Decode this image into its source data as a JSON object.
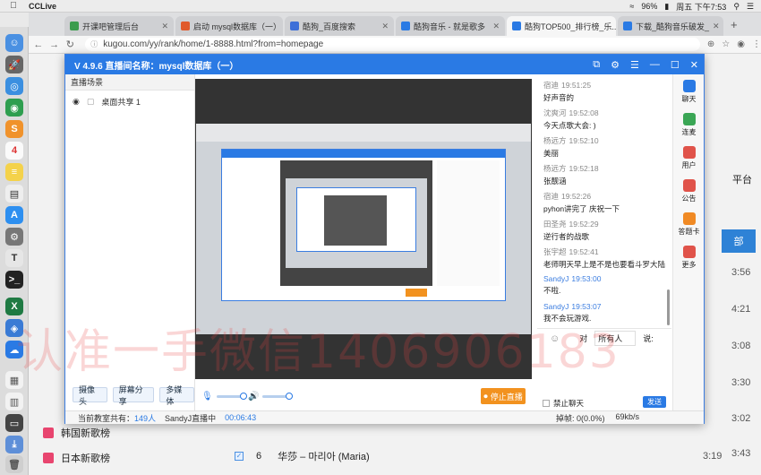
{
  "menubar": {
    "app_name": "CCLive",
    "battery": "96%",
    "clock": "周五 下午7:53"
  },
  "tabs": [
    {
      "label": "开课吧管理后台",
      "color": "#3b9c4d"
    },
    {
      "label": "启动 mysql数据库（一）",
      "color": "#e05a2b"
    },
    {
      "label": "酷狗_百度搜索",
      "color": "#3d6fd8"
    },
    {
      "label": "酷狗音乐 - 就是歌多",
      "color": "#2a7ae4"
    },
    {
      "label": "酷狗TOP500_排行榜_乐...",
      "color": "#2a7ae4"
    },
    {
      "label": "下载_酷狗音乐破发_",
      "color": "#2a7ae4"
    }
  ],
  "browser": {
    "url": "kugou.com/yy/rank/home/1-8888.html?from=homepage",
    "new_tab": "+"
  },
  "kugou": {
    "platform": "平台",
    "all_button": "部",
    "ranks": [
      {
        "label": "韩国新歌榜"
      },
      {
        "label": "日本新歌榜"
      }
    ],
    "song": {
      "index": "6",
      "name": "华莎 – 마리아 (Maria)",
      "duration": "3:19"
    },
    "times": [
      "3:56",
      "4:21",
      "3:08",
      "3:30",
      "3:02",
      "3:43"
    ]
  },
  "app": {
    "title": "V 4.9.6  直播间名称：mysql数据库（一）",
    "left_header": "直播场景",
    "share_label": "桌面共享 1",
    "buttons": {
      "camera": "摄像头",
      "screen": "屏幕分享",
      "media": "多媒体"
    },
    "stop_label": "停止直播",
    "status": {
      "prefix": "当前教室共有：",
      "count": "149人",
      "host": "SandyJ直播中",
      "timer": "00:06:43",
      "loss": "掉帧: 0(0.0%)",
      "speed": "69kb/s"
    },
    "chat": {
      "messages": [
        {
          "who": "宿迪",
          "time": "19:51:25",
          "text": "好声音的",
          "teacher": false
        },
        {
          "who": "沈爽河",
          "time": "19:52:08",
          "text": "今天点歌大会: )",
          "teacher": false
        },
        {
          "who": "杨远方",
          "time": "19:52:10",
          "text": "美丽",
          "teacher": false
        },
        {
          "who": "杨远方",
          "time": "19:52:18",
          "text": "张靓涵",
          "teacher": false
        },
        {
          "who": "宿迪",
          "time": "19:52:26",
          "text": "pyhon讲完了 庆祝一下",
          "teacher": false
        },
        {
          "who": "田圣尧",
          "time": "19:52:29",
          "text": "逆行者的战歌",
          "teacher": false
        },
        {
          "who": "张宇超",
          "time": "19:52:41",
          "text": "老师明天早上是不是也要看斗罗大陆",
          "teacher": false
        },
        {
          "who": "SandyJ",
          "time": "19:53:00",
          "text": "不啦.",
          "teacher": true
        },
        {
          "who": "SandyJ",
          "time": "19:53:07",
          "text": "我不会玩游戏.",
          "teacher": true
        }
      ],
      "to_label": "对",
      "target": "所有人",
      "say": "说:",
      "mute": "禁止聊天",
      "send": "发送"
    },
    "rightbar": [
      {
        "label": "聊天",
        "color": "#2a7ae4"
      },
      {
        "label": "连麦",
        "color": "#3aa655"
      },
      {
        "label": "用户",
        "color": "#e0534a"
      },
      {
        "label": "公告",
        "color": "#e0534a"
      },
      {
        "label": "答题卡",
        "color": "#f08a24"
      },
      {
        "label": "更多",
        "color": "#e0534a"
      }
    ]
  },
  "watermark": "认准一手微信1406906183"
}
